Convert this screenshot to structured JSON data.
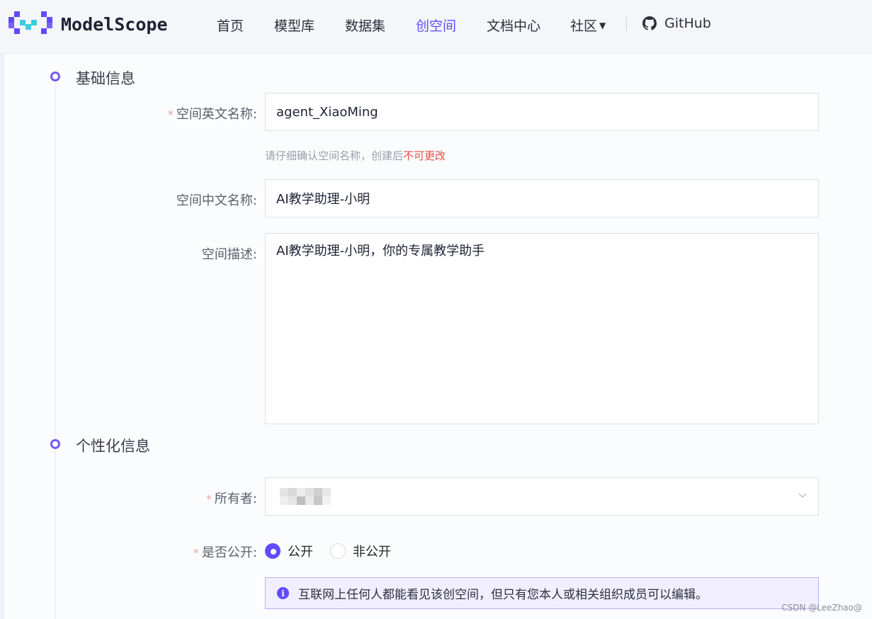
{
  "header": {
    "logo_text": "ModelScope",
    "nav": [
      {
        "label": "首页"
      },
      {
        "label": "模型库"
      },
      {
        "label": "数据集"
      },
      {
        "label": "创空间",
        "active": true
      },
      {
        "label": "文档中心"
      },
      {
        "label": "社区"
      }
    ],
    "github_label": "GitHub",
    "accent_color": "#624aff"
  },
  "form": {
    "basic_section_title": "基础信息",
    "en_name": {
      "label": "空间英文名称:",
      "value": "agent_XiaoMing",
      "required": true
    },
    "en_name_hint_prefix": "请仔细确认空间名称，创建后",
    "en_name_hint_danger": "不可更改",
    "cn_name": {
      "label": "空间中文名称:",
      "value": "AI教学助理-小明"
    },
    "description": {
      "label": "空间描述:",
      "value": "AI教学助理-小明，你的专属教学助手"
    },
    "personal_section_title": "个性化信息",
    "owner": {
      "label": "所有者:",
      "required": true
    },
    "visibility": {
      "label": "是否公开:",
      "required": true,
      "options": [
        {
          "label": "公开",
          "checked": true
        },
        {
          "label": "非公开",
          "checked": false
        }
      ]
    },
    "visibility_note": "互联网上任何人都能看见该创空间，但只有您本人或相关组织成员可以编辑。"
  },
  "watermark": "CSDN @LeeZhao@"
}
